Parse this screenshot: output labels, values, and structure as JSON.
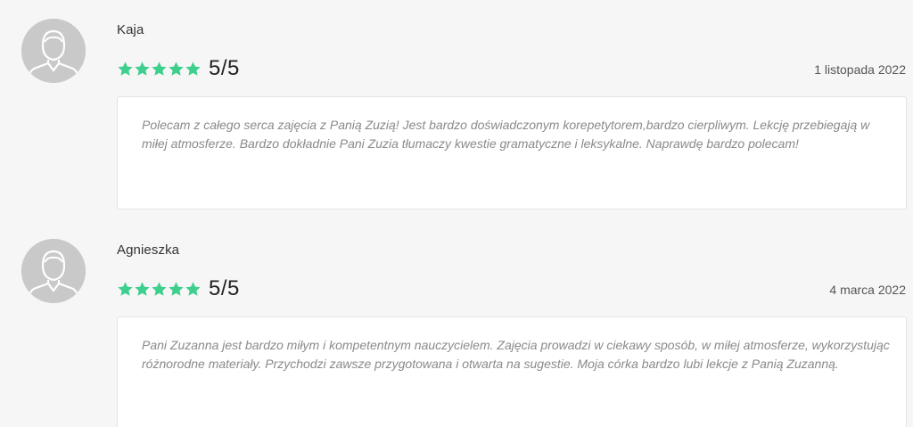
{
  "colors": {
    "star": "#3ecf8e",
    "avatar": "#c9c9c9"
  },
  "reviews": [
    {
      "name": "Kaja",
      "score": "5/5",
      "stars": 5,
      "date": "1 listopada 2022",
      "text": "Polecam z całego serca zajęcia z Panią Zuzią! Jest bardzo doświadczonym korepetytorem,bardzo cierpliwym. Lekcję przebiegają w miłej atmosferze. Bardzo dokładnie Pani Zuzia tłumaczy kwestie gramatyczne i leksykalne. Naprawdę bardzo polecam!"
    },
    {
      "name": "Agnieszka",
      "score": "5/5",
      "stars": 5,
      "date": "4 marca 2022",
      "text": "Pani Zuzanna jest bardzo miłym i kompetentnym nauczycielem. Zajęcia prowadzi w ciekawy sposób, w miłej atmosferze, wykorzystując różnorodne materiały. Przychodzi zawsze przygotowana i otwarta na sugestie. Moja córka bardzo lubi lekcje z Panią Zuzanną."
    }
  ]
}
